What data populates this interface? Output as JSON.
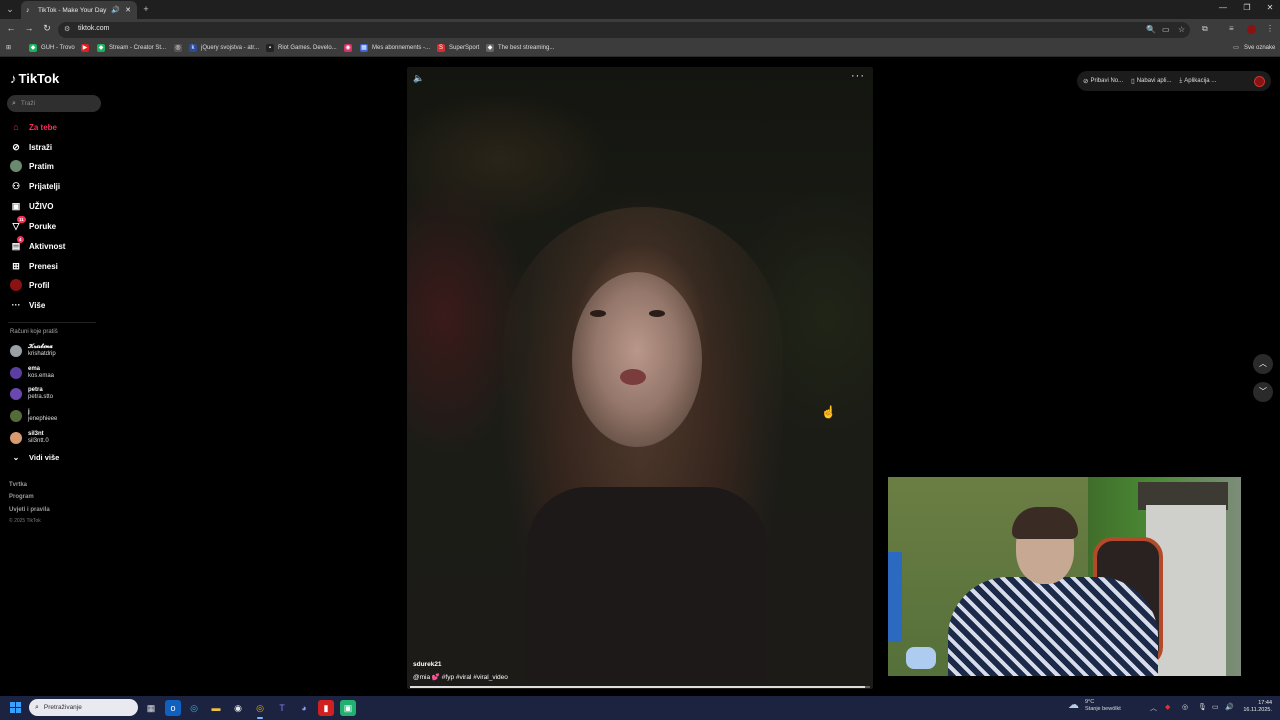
{
  "browser": {
    "tab_title": "TikTok - Make Your Day",
    "url": "tiktok.com",
    "bookmarks": [
      {
        "label": "GUH - Trovo",
        "color": "#19b35c"
      },
      {
        "label": "",
        "color": "#e02020"
      },
      {
        "label": "Stream - Creator St...",
        "color": "#19b35c"
      },
      {
        "label": "",
        "color": "#888888"
      },
      {
        "label": "jQuery svojstva - atr...",
        "color": "#2a4a9a"
      },
      {
        "label": "Riot Games. Develo...",
        "color": "#222222"
      },
      {
        "label": "",
        "color": "#d6306a"
      },
      {
        "label": "Mes abonnements -...",
        "color": "#3a66d8"
      },
      {
        "label": "SuperSport",
        "color": "#d62e2e"
      },
      {
        "label": "The best streaming...",
        "color": "#666666"
      }
    ],
    "all_bookmarks_label": "Sve oznake"
  },
  "tiktok": {
    "logo": "TikTok",
    "search_placeholder": "Traži",
    "nav": {
      "for_you": "Za tebe",
      "explore": "Istraži",
      "following": "Pratim",
      "friends": "Prijatelji",
      "live": "UŽIVO",
      "messages": "Poruke",
      "messages_badge": "11",
      "activity": "Aktivnost",
      "activity_badge": "4",
      "upload": "Prenesi",
      "profile": "Profil",
      "more": "Više"
    },
    "following_title": "Računi koje pratiš",
    "accounts": [
      {
        "name": "𝓚𝓻𝓲𝓼𝓽𝓲𝓷𝓪",
        "handle": "krishatdrip",
        "color": "#9aa0a6"
      },
      {
        "name": "ema",
        "handle": "kos.emaa",
        "color": "#5b3fa0"
      },
      {
        "name": "petra",
        "handle": "petra.stto",
        "color": "#6a48b0"
      },
      {
        "name": "j",
        "handle": "jenephieee",
        "color": "#556b3a"
      },
      {
        "name": "sil3nt",
        "handle": "sil3ntt.0",
        "color": "#d89a70"
      }
    ],
    "see_more": "Vidi više",
    "footer": [
      "Tvrtka",
      "Program",
      "Uvjeti i pravila"
    ],
    "copyright": "© 2025 TikTok",
    "top_pills": [
      "Pribavi No...",
      "Nabavi apli...",
      "Aplikacija ..."
    ],
    "video": {
      "username": "sdurek21",
      "caption": "@mia 💕 #fyp #viral #viral_video",
      "progress": 0.99
    }
  },
  "taskbar": {
    "search_placeholder": "Pretraživanje",
    "weather_temp": "9°C",
    "weather_desc": "Stanje bewölkt",
    "time": "17:44",
    "date": "16.11.2025."
  }
}
